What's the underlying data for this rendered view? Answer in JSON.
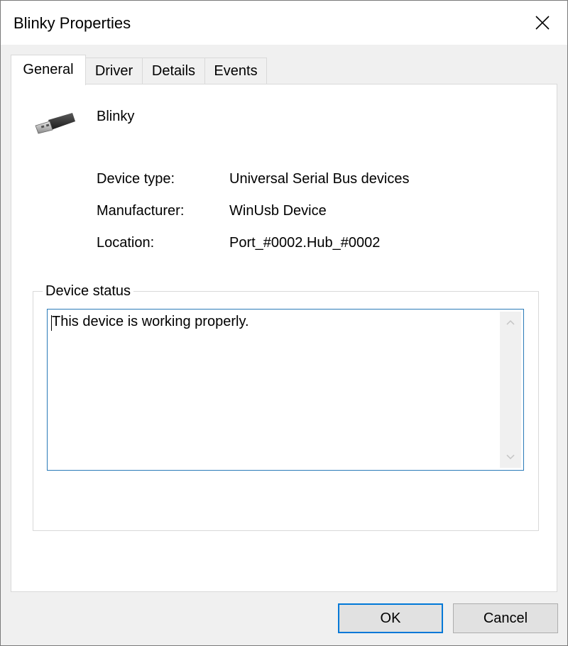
{
  "window": {
    "title": "Blinky Properties"
  },
  "tabs": [
    {
      "label": "General",
      "active": true
    },
    {
      "label": "Driver",
      "active": false
    },
    {
      "label": "Details",
      "active": false
    },
    {
      "label": "Events",
      "active": false
    }
  ],
  "device": {
    "name": "Blinky",
    "icon": "usb-plug-icon",
    "properties": [
      {
        "label": "Device type:",
        "value": "Universal Serial Bus devices"
      },
      {
        "label": "Manufacturer:",
        "value": "WinUsb Device"
      },
      {
        "label": "Location:",
        "value": "Port_#0002.Hub_#0002"
      }
    ]
  },
  "status": {
    "group_title": "Device status",
    "text": "This device is working properly."
  },
  "buttons": {
    "ok": "OK",
    "cancel": "Cancel"
  },
  "colors": {
    "accent": "#0078d7",
    "focus_border": "#2a7ab8"
  }
}
